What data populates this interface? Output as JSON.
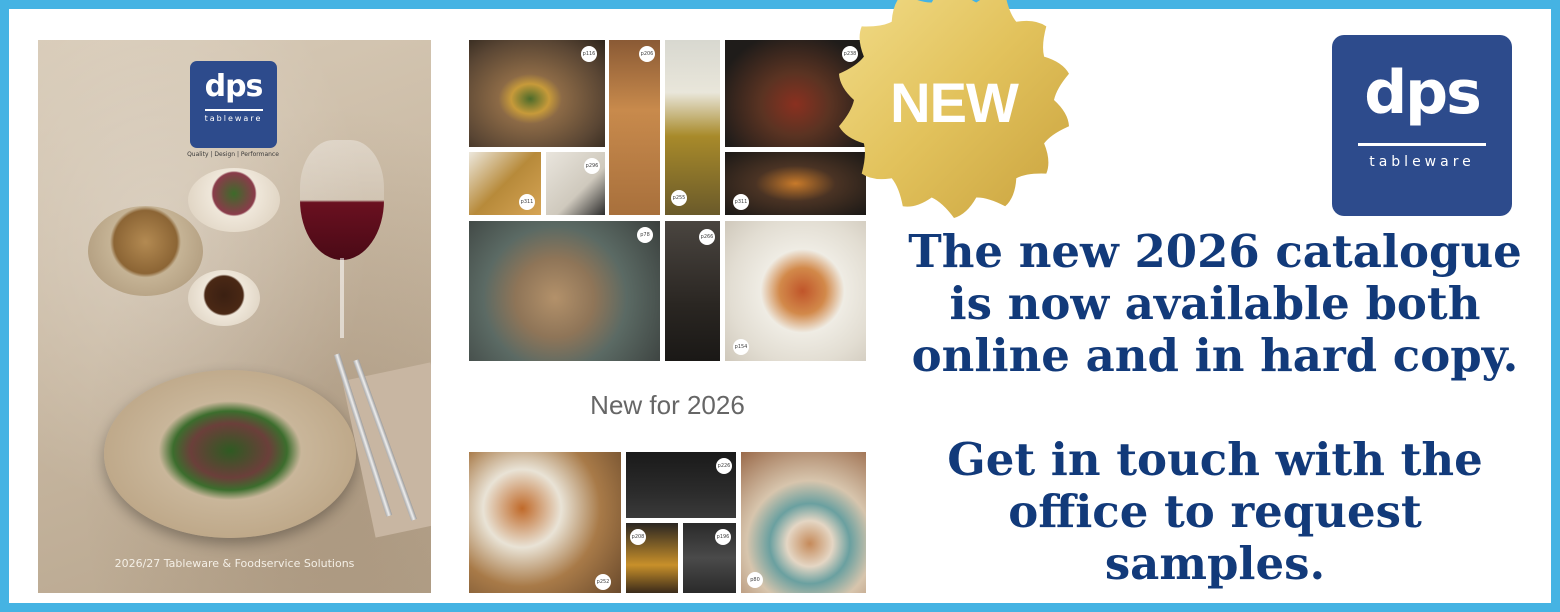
{
  "cover": {
    "logo_main": "dps",
    "logo_sub": "tableware",
    "tagline": "Quality | Design | Performance",
    "footer": "2026/27 Tableware & Foodservice Solutions"
  },
  "collage": {
    "heading": "New for 2026",
    "page_refs": [
      "p116",
      "p206",
      "p238",
      "p311",
      "p296",
      "p255",
      "p311",
      "p78",
      "p266",
      "p154",
      "p226",
      "p208",
      "p196",
      "p252",
      "p80"
    ]
  },
  "badge": {
    "label": "NEW",
    "color": "#e2c25c"
  },
  "brand": {
    "logo_main": "dps",
    "logo_sub": "tableware",
    "color": "#2d4b8c"
  },
  "message": {
    "lines_1": [
      "The new 2026 catalogue",
      "is now available both",
      "online and in hard copy."
    ],
    "lines_2": [
      "Get in touch with the",
      "office to request",
      "samples."
    ]
  },
  "colors": {
    "frame": "#45b3e3",
    "text": "#123a7a"
  }
}
